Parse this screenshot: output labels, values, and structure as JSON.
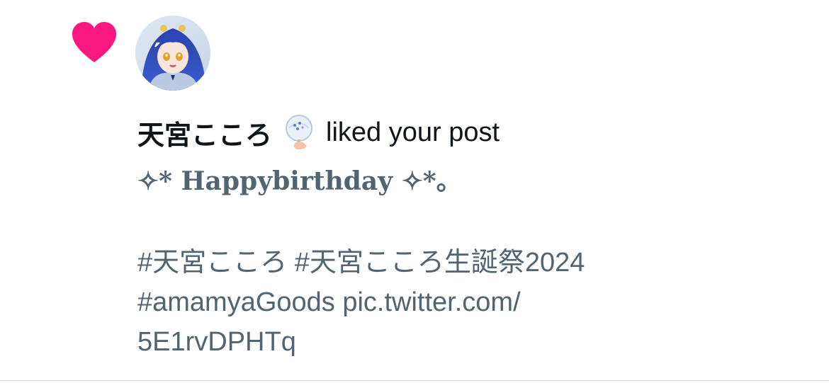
{
  "notification": {
    "type_icon": "heart-icon",
    "type_icon_color": "#f91880",
    "avatar_alt": "avatar",
    "user_name": "天宮こころ",
    "user_badge_icon": "hand-fan-emoji",
    "action_text": "liked your post",
    "post": {
      "title": "✧* Happybirthday ✧*。",
      "lines": [
        "#天宮こころ #天宮こころ生誕祭2024",
        "#amamyaGoods pic.twitter.com/",
        "5E1rvDPHTq"
      ]
    }
  },
  "colors": {
    "text_primary": "#0f1419",
    "text_secondary": "#536471",
    "like_pink": "#f91880",
    "divider": "#cfd9de"
  }
}
